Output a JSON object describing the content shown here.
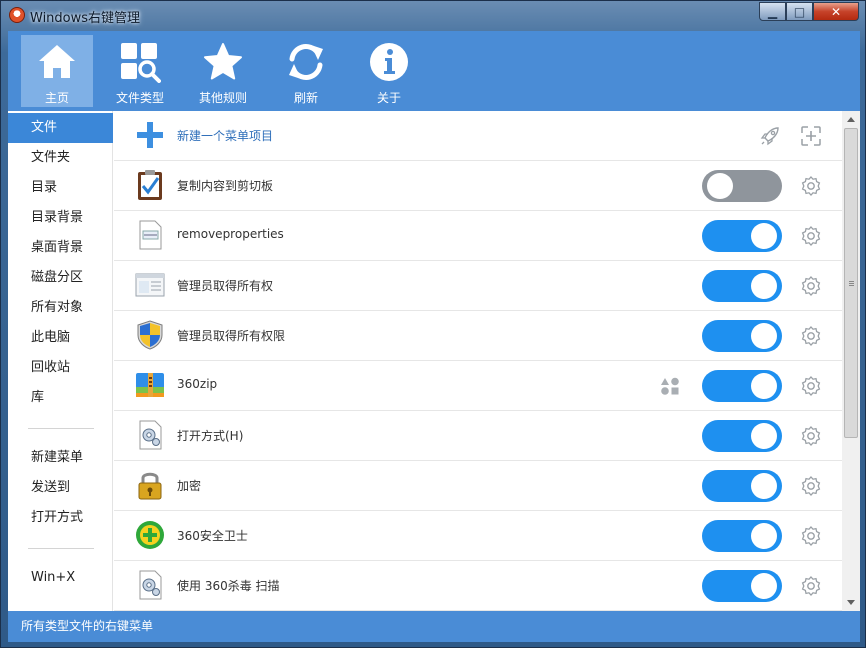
{
  "window": {
    "title": "Windows右键管理"
  },
  "titlebar_buttons": {
    "min": "▁",
    "max": "□",
    "close": "✕"
  },
  "toolbar": {
    "items": [
      {
        "label": "主页",
        "icon": "home-icon",
        "active": true
      },
      {
        "label": "文件类型",
        "icon": "grid-search-icon",
        "active": false
      },
      {
        "label": "其他规则",
        "icon": "star-icon",
        "active": false
      },
      {
        "label": "刷新",
        "icon": "refresh-icon",
        "active": false
      },
      {
        "label": "关于",
        "icon": "info-icon",
        "active": false
      }
    ]
  },
  "sidebar": {
    "items": [
      {
        "label": "文件",
        "active": true
      },
      {
        "label": "文件夹"
      },
      {
        "label": "目录"
      },
      {
        "label": "目录背景"
      },
      {
        "label": "桌面背景"
      },
      {
        "label": "磁盘分区"
      },
      {
        "label": "所有对象"
      },
      {
        "label": "此电脑"
      },
      {
        "label": "回收站"
      },
      {
        "label": "库"
      },
      {
        "label": "新建菜单"
      },
      {
        "label": "发送到"
      },
      {
        "label": "打开方式"
      },
      {
        "label": "Win+X"
      }
    ]
  },
  "list": {
    "new_item_label": "新建一个菜单项目",
    "rows": [
      {
        "label": "复制内容到剪切板",
        "icon": "clipboard-icon",
        "enabled": false
      },
      {
        "label": "removeproperties",
        "icon": "document-icon",
        "enabled": true
      },
      {
        "label": "管理员取得所有权",
        "icon": "window-app-icon",
        "enabled": true
      },
      {
        "label": "管理员取得所有权限",
        "icon": "uac-shield-icon",
        "enabled": true
      },
      {
        "label": "360zip",
        "icon": "zip-archive-icon",
        "enabled": true,
        "extra_icon": "shapes-icon"
      },
      {
        "label": "打开方式(H)",
        "icon": "settings-document-icon",
        "enabled": true
      },
      {
        "label": "加密",
        "icon": "padlock-icon",
        "enabled": true
      },
      {
        "label": "360安全卫士",
        "icon": "360-safe-icon",
        "enabled": true
      },
      {
        "label": "使用 360杀毒 扫描",
        "icon": "settings-document-icon",
        "enabled": true
      }
    ]
  },
  "status_bar": {
    "text": "所有类型文件的右键菜单"
  },
  "colors": {
    "accent": "#4a8cd6",
    "toggle_on": "#1e90f0",
    "toggle_off": "#8f959c",
    "sidebar_active": "#3b87d8"
  }
}
